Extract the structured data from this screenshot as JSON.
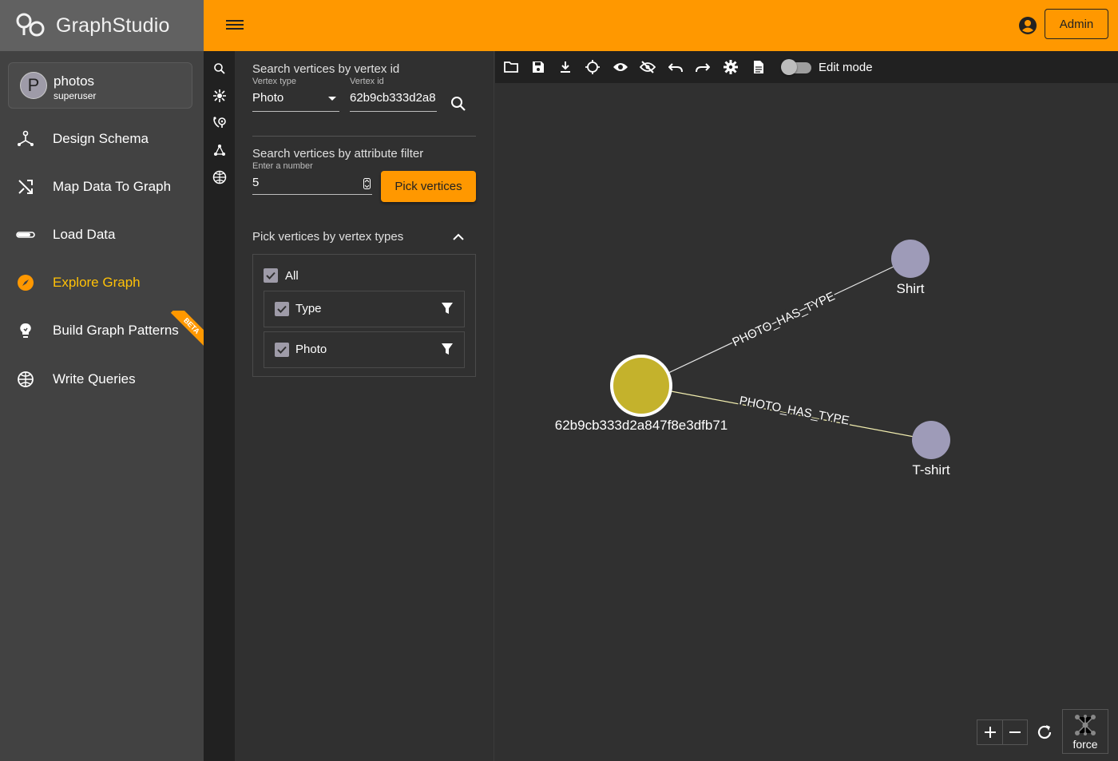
{
  "app": {
    "brand": "GraphStudio"
  },
  "header": {
    "admin_label": "Admin"
  },
  "user": {
    "initial": "P",
    "name": "photos",
    "role": "superuser"
  },
  "sidebar": {
    "items": [
      {
        "label": "Design Schema",
        "icon": "schema-icon"
      },
      {
        "label": "Map Data To Graph",
        "icon": "shuffle-icon"
      },
      {
        "label": "Load Data",
        "icon": "progress-icon"
      },
      {
        "label": "Explore Graph",
        "icon": "compass-icon",
        "active": true
      },
      {
        "label": "Build Graph Patterns",
        "icon": "lightbulb-icon",
        "badge": "BETA"
      },
      {
        "label": "Write Queries",
        "icon": "globe-icon"
      }
    ]
  },
  "search_panel": {
    "vertex_id_title": "Search vertices by vertex id",
    "vertex_type_label": "Vertex type",
    "vertex_type_value": "Photo",
    "vertex_id_label": "Vertex id",
    "vertex_id_value": "62b9cb333d2a8",
    "attr_filter_title": "Search vertices by attribute filter",
    "number_label": "Enter a number",
    "number_value": "5",
    "pick_button": "Pick vertices",
    "types_title": "Pick vertices by vertex types",
    "all_label": "All",
    "types": [
      {
        "label": "Type"
      },
      {
        "label": "Photo"
      }
    ]
  },
  "toolbar": {
    "edit_mode_label": "Edit mode",
    "icons": [
      "folder-icon",
      "save-icon",
      "download-icon",
      "locate-icon",
      "show-icon",
      "hide-icon",
      "undo-icon",
      "redo-icon",
      "settings-icon",
      "document-icon"
    ]
  },
  "graph": {
    "nodes": [
      {
        "label": "62b9cb333d2a847f8e3dfb71",
        "type": "Photo",
        "color": "#c4b22c"
      },
      {
        "label": "Shirt",
        "type": "Type",
        "color": "#9e9bb8"
      },
      {
        "label": "T-shirt",
        "type": "Type",
        "color": "#9e9bb8"
      }
    ],
    "edges": [
      {
        "label": "PHOTO_HAS_TYPE",
        "from": "62b9cb333d2a847f8e3dfb71",
        "to": "Shirt"
      },
      {
        "label": "PHOTO_HAS_TYPE",
        "from": "62b9cb333d2a847f8e3dfb71",
        "to": "T-shirt"
      }
    ],
    "layout_label": "force"
  },
  "colors": {
    "accent": "#ff9800",
    "active_nav": "#ffc107"
  }
}
